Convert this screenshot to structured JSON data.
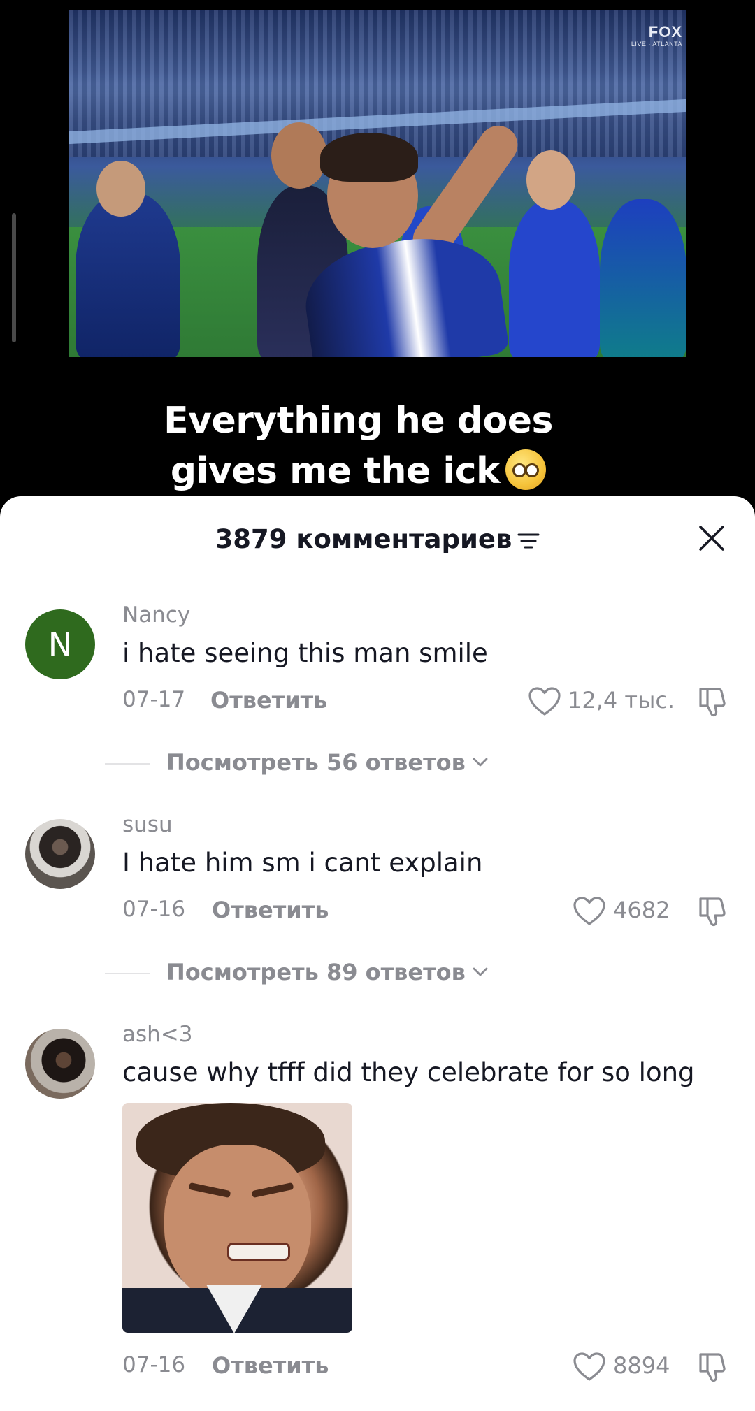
{
  "video": {
    "caption_line1": "Everything he does",
    "caption_line2": "gives me the ick",
    "emoji": "pleading-face-emoji",
    "broadcaster": "FOX",
    "broadcaster_sub": "LIVE · ATLANTA"
  },
  "comments_sheet": {
    "title": "3879 комментариев",
    "sort_icon": "sort-lines-icon",
    "close_icon": "close-icon"
  },
  "comments": [
    {
      "avatar_letter": "N",
      "avatar_color": "#2f6a1e",
      "username": "Nancy",
      "text": "i hate seeing this man smile",
      "date": "07-17",
      "reply_label": "Ответить",
      "likes": "12,4 тыс.",
      "view_replies": "Посмотреть 56 ответов"
    },
    {
      "username": "susu",
      "text": "I hate him sm i cant explain",
      "date": "07-16",
      "reply_label": "Ответить",
      "likes": "4682",
      "view_replies": "Посмотреть 89 ответов"
    },
    {
      "username": "ash<3",
      "text": "cause why tfff did they celebrate for so long",
      "has_sticker": true,
      "date": "07-16",
      "reply_label": "Ответить",
      "likes": "8894"
    }
  ],
  "colors": {
    "text_primary": "#161823",
    "text_secondary": "#8a8b91",
    "sheet_bg": "#ffffff",
    "background": "#000000"
  }
}
